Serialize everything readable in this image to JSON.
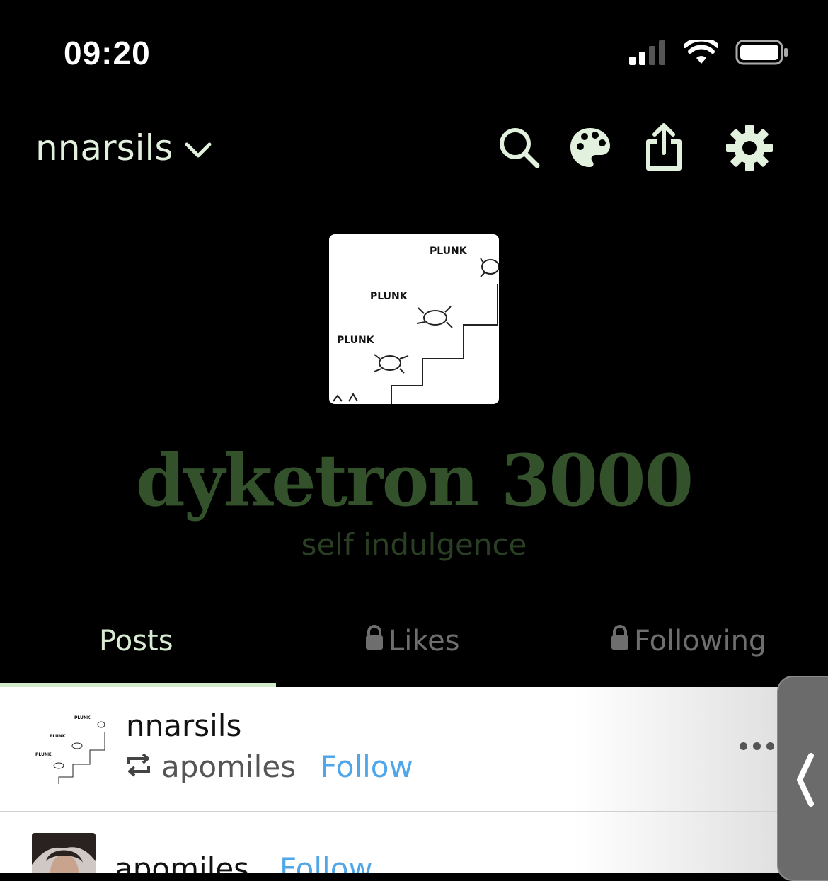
{
  "status": {
    "time": "09:20"
  },
  "header": {
    "blog_name": "nnarsils"
  },
  "blog": {
    "title": "dyketron 3000",
    "description": "self indulgence",
    "avatar_labels": [
      "PLUNK",
      "PLUNK",
      "PLUNK"
    ]
  },
  "tabs": [
    {
      "label": "Posts",
      "locked": false,
      "selected": true
    },
    {
      "label": "Likes",
      "locked": true,
      "selected": false
    },
    {
      "label": "Following",
      "locked": true,
      "selected": false
    }
  ],
  "feed": {
    "post": {
      "user": "nnarsils",
      "reblogged_from": "apomiles",
      "follow_label": "Follow"
    },
    "next": {
      "user": "apomiles",
      "follow_label": "Follow"
    }
  },
  "colors": {
    "accent": "#d2ebcb",
    "title": "#33512b",
    "link": "#4fa6e8",
    "background": "#000000"
  }
}
